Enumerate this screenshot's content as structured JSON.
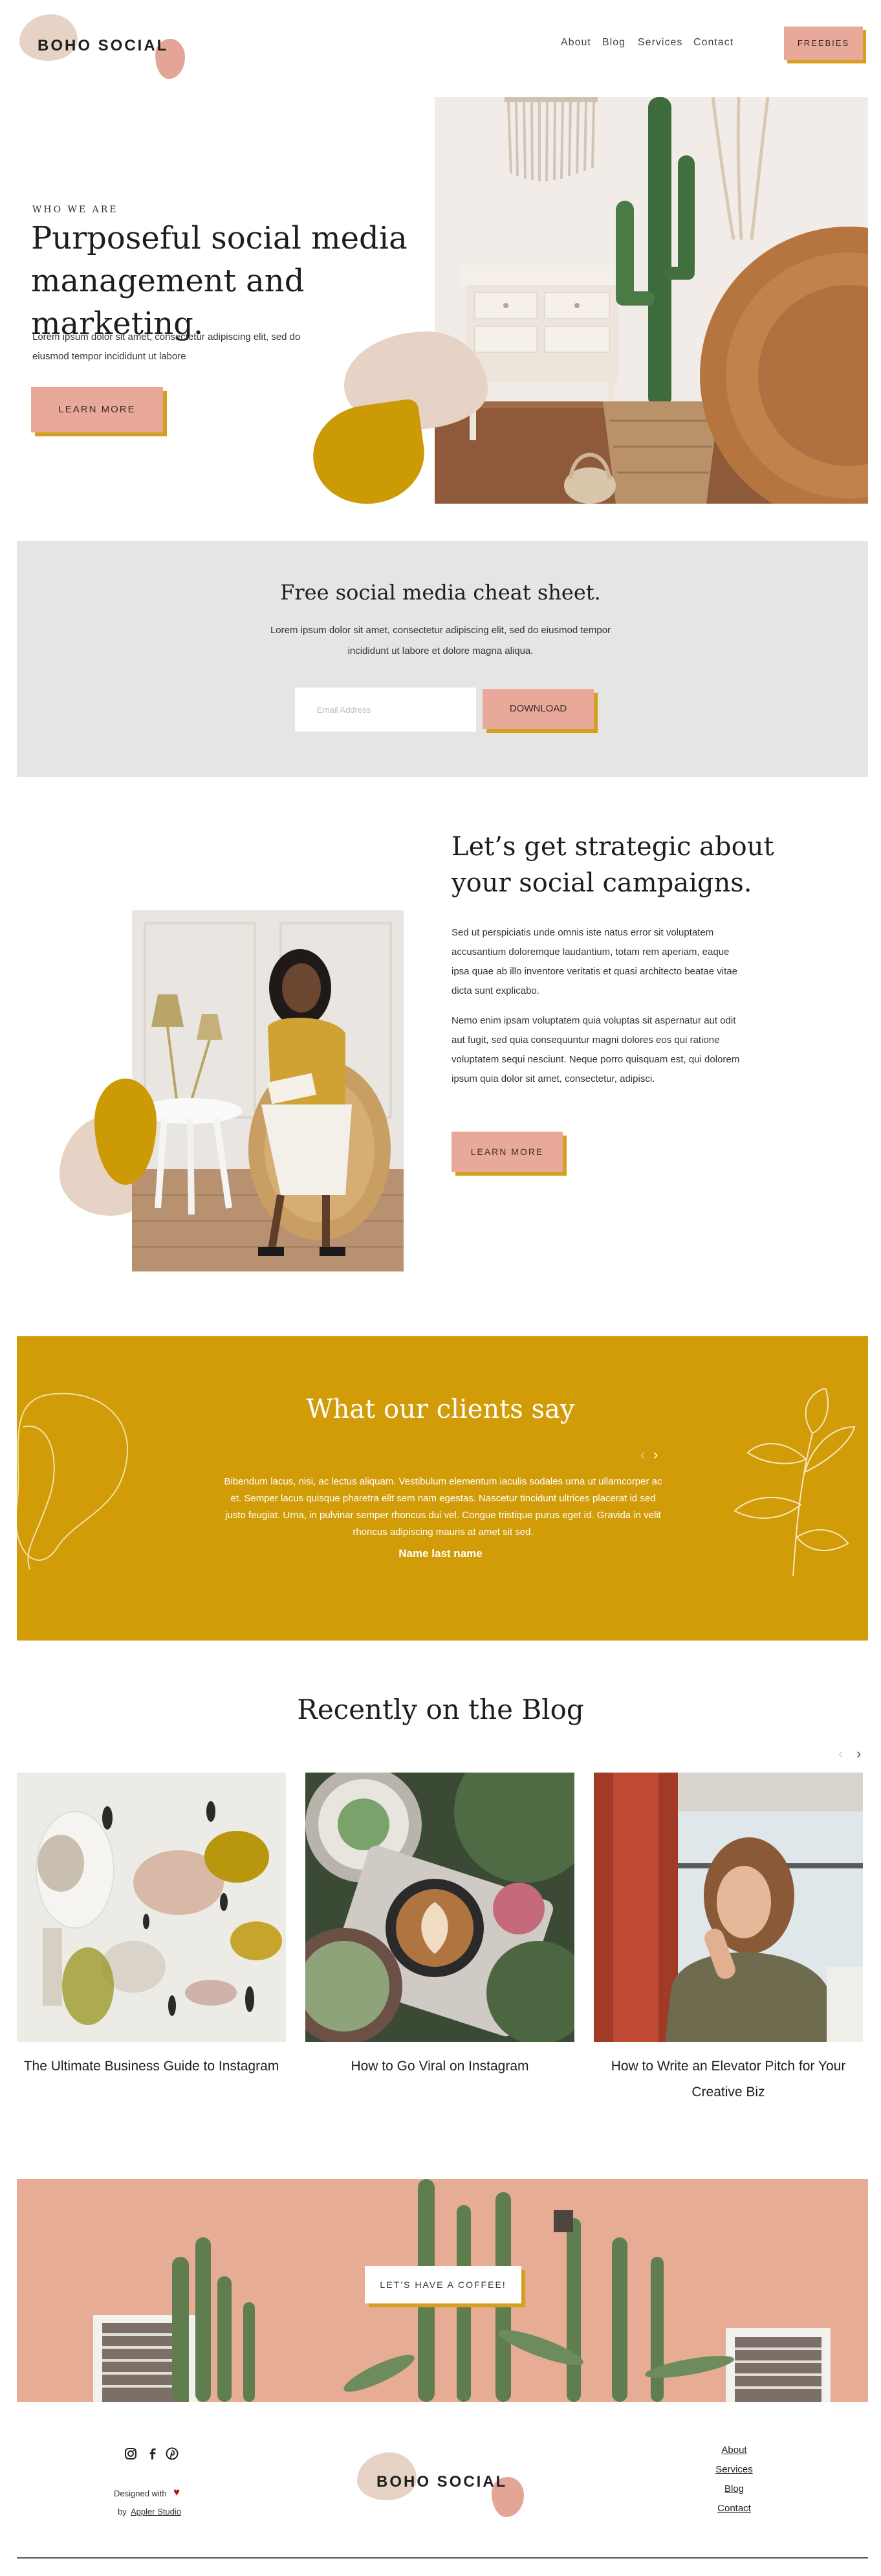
{
  "header": {
    "logo": "BOHO SOCIAL",
    "nav": [
      "About",
      "Blog",
      "Services",
      "Contact"
    ],
    "cta_label": "FREEBIES"
  },
  "hero": {
    "eyebrow": "WHO WE ARE",
    "title": "Purposeful social media management and marketing.",
    "body": "Lorem ipsum dolor sit amet, consectetur adipiscing elit, sed do eiusmod tempor incididunt ut labore",
    "button": "LEARN MORE"
  },
  "cheatsheet": {
    "title": "Free social media cheat sheet.",
    "body": "Lorem ipsum dolor sit amet, consectetur adipiscing elit, sed do eiusmod tempor incididunt ut labore et dolore magna aliqua.",
    "email_placeholder": "Email Address",
    "button": "DOWNLOAD"
  },
  "strategic": {
    "title": "Let’s get strategic about your social campaigns.",
    "p1": "Sed ut perspiciatis unde omnis iste natus error sit voluptatem accusantium doloremque laudantium, totam rem aperiam, eaque ipsa quae ab illo inventore veritatis et quasi architecto beatae vitae dicta sunt explicabo.",
    "p2": "Nemo enim ipsam voluptatem quia voluptas sit aspernatur aut odit aut fugit, sed quia consequuntur magni dolores eos qui ratione voluptatem sequi nesciunt. Neque porro quisquam est, qui dolorem ipsum quia dolor sit amet, consectetur, adipisci.",
    "button": "LEARN MORE"
  },
  "testimonials": {
    "title": "What our clients say",
    "quote": "Bibendum lacus, nisi, ac lectus aliquam. Vestibulum elementum iaculis sodales urna ut ullamcorper ac et. Semper lacus quisque pharetra elit sem nam egestas. Nascetur tincidunt ultrices placerat id sed justo feugiat. Urna, in pulvinar semper rhoncus dui vel. Congue tristique purus eget id. Gravida in velit rhoncus adipiscing mauris at amet sit sed.",
    "name": "Name last name",
    "prev": "‹",
    "next": "›"
  },
  "blog": {
    "title": "Recently on the Blog",
    "prev": "‹",
    "next": "›",
    "posts": [
      {
        "title": "The Ultimate Business Guide to Instagram"
      },
      {
        "title": "How to Go Viral on Instagram"
      },
      {
        "title": "How to Write an Elevator Pitch for Your Creative Biz"
      }
    ]
  },
  "cta": {
    "button": "LET’S HAVE A COFFEE!"
  },
  "footer": {
    "social_icons": [
      "instagram-icon",
      "facebook-icon",
      "pinterest-icon"
    ],
    "designed_with": "Designed with",
    "heart": "♥",
    "by": "by",
    "studio": "Appler Studio",
    "logo": "BOHO SOCIAL",
    "links": [
      "About",
      "Services",
      "Blog",
      "Contact"
    ]
  },
  "colors": {
    "accent_pink": "#e8a99a",
    "accent_gold": "#d19c08",
    "beige": "#e6d3c5",
    "cheat_bg": "#e5e6e4"
  }
}
